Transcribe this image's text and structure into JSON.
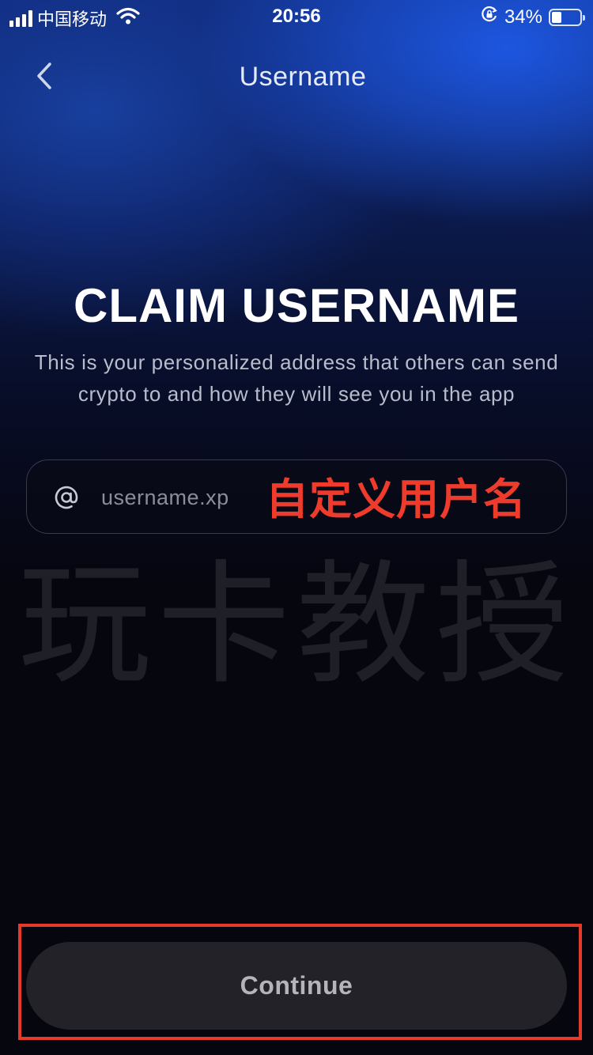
{
  "status_bar": {
    "carrier": "中国移动",
    "time": "20:56",
    "battery": "34%",
    "battery_level": 0.34
  },
  "nav": {
    "title": "Username"
  },
  "content": {
    "headline": "CLAIM USERNAME",
    "description": "This is your personalized address that others can send crypto to and how they will see you in the app"
  },
  "username_field": {
    "prefix_icon": "at-icon",
    "placeholder": "username.xp",
    "value": ""
  },
  "annotation": {
    "label": "自定义用户名",
    "color": "#ee3b2c"
  },
  "watermark": {
    "text": "玩卡教授"
  },
  "footer": {
    "continue_label": "Continue",
    "highlight_color": "#e53a2a"
  }
}
